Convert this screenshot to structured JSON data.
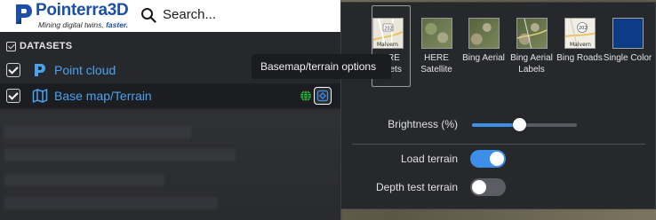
{
  "header": {
    "brand_name": "Pointerra3D",
    "tagline": "Mining digital twins,",
    "tagline_emphasis": "faster.",
    "search_placeholder": "Search..."
  },
  "datasets": {
    "heading": "DATASETS",
    "items": [
      {
        "label": "Point cloud",
        "checked": true,
        "icon": "pointerra-p-icon"
      },
      {
        "label": "Base map/Terrain",
        "checked": true,
        "icon": "map-icon"
      }
    ]
  },
  "tooltip": {
    "text": "Basemap/terrain options"
  },
  "basemap": {
    "tiles": [
      {
        "label": "HERE Streets",
        "thumb_text": "Malvern",
        "selected": true
      },
      {
        "label": "HERE Satellite",
        "selected": false
      },
      {
        "label": "Bing Aerial",
        "selected": false
      },
      {
        "label": "Bing Aerial Labels",
        "selected": false
      },
      {
        "label": "Bing Roads",
        "thumb_text": "Malvern",
        "selected": false
      },
      {
        "label": "Single Color",
        "selected": false,
        "color": "#0d3c87"
      }
    ],
    "brightness_label": "Brightness (%)",
    "brightness_value": 0.45,
    "load_terrain_label": "Load terrain",
    "load_terrain": true,
    "depth_test_label": "Depth test terrain",
    "depth_test": false
  },
  "colors": {
    "accent": "#3d8ee6",
    "link": "#4aa3f0",
    "brand": "#1c4fa8",
    "panel_bg": "#27282c"
  }
}
